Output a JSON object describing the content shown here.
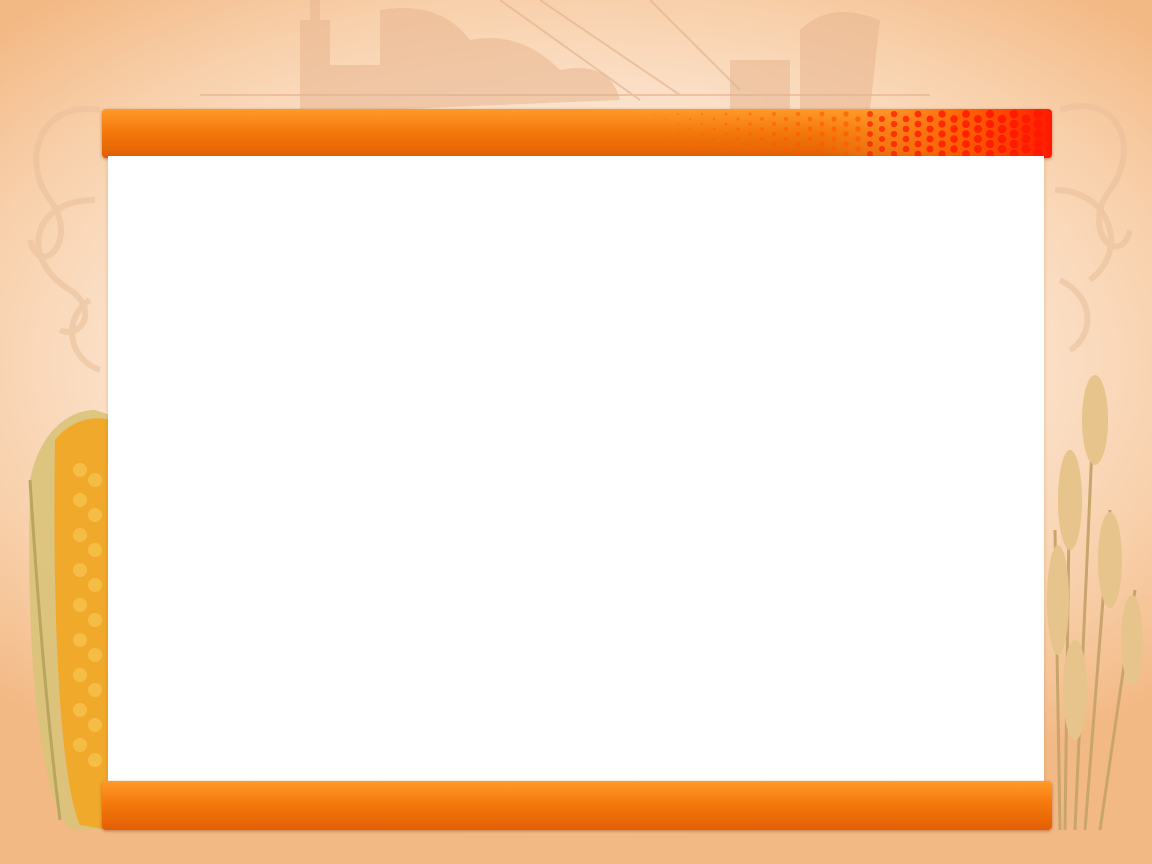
{
  "slide": {
    "title": "",
    "body_text": "",
    "footer_text": ""
  },
  "theme": {
    "accent": "#f57a0c",
    "accent_dark": "#e35e04",
    "halftone_red": "#ff1a00",
    "background": "#fde9d8",
    "content_background": "#ffffff"
  },
  "decor": {
    "left_image": "corn-cob",
    "right_image": "wheat-stalks",
    "top_image": "industrial-skyline"
  }
}
